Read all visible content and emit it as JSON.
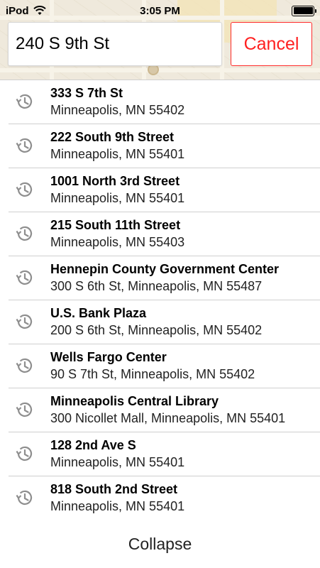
{
  "status_bar": {
    "carrier": "iPod",
    "time": "3:05 PM"
  },
  "search": {
    "query": "240 S 9th St",
    "cancel_label": "Cancel"
  },
  "results": [
    {
      "title": "333 S 7th St",
      "subtitle": "Minneapolis, MN 55402",
      "icon": "history-icon"
    },
    {
      "title": "222 South 9th Street",
      "subtitle": "Minneapolis, MN 55401",
      "icon": "history-icon"
    },
    {
      "title": "1001 North 3rd Street",
      "subtitle": "Minneapolis, MN 55401",
      "icon": "history-icon"
    },
    {
      "title": "215 South 11th Street",
      "subtitle": "Minneapolis, MN 55403",
      "icon": "history-icon"
    },
    {
      "title": "Hennepin County Government Center",
      "subtitle": "300 S 6th St, Minneapolis, MN 55487",
      "icon": "history-icon"
    },
    {
      "title": "U.S. Bank Plaza",
      "subtitle": "200 S 6th St, Minneapolis, MN 55402",
      "icon": "history-icon"
    },
    {
      "title": "Wells Fargo Center",
      "subtitle": "90 S 7th St, Minneapolis, MN 55402",
      "icon": "history-icon"
    },
    {
      "title": "Minneapolis Central Library",
      "subtitle": "300 Nicollet Mall, Minneapolis, MN 55401",
      "icon": "history-icon"
    },
    {
      "title": "128 2nd Ave S",
      "subtitle": "Minneapolis, MN 55401",
      "icon": "history-icon"
    },
    {
      "title": "818 South 2nd Street",
      "subtitle": "Minneapolis, MN 55401",
      "icon": "history-icon"
    }
  ],
  "footer": {
    "collapse_label": "Collapse"
  },
  "colors": {
    "accent": "#ff2020",
    "divider": "#cfcfcf"
  }
}
